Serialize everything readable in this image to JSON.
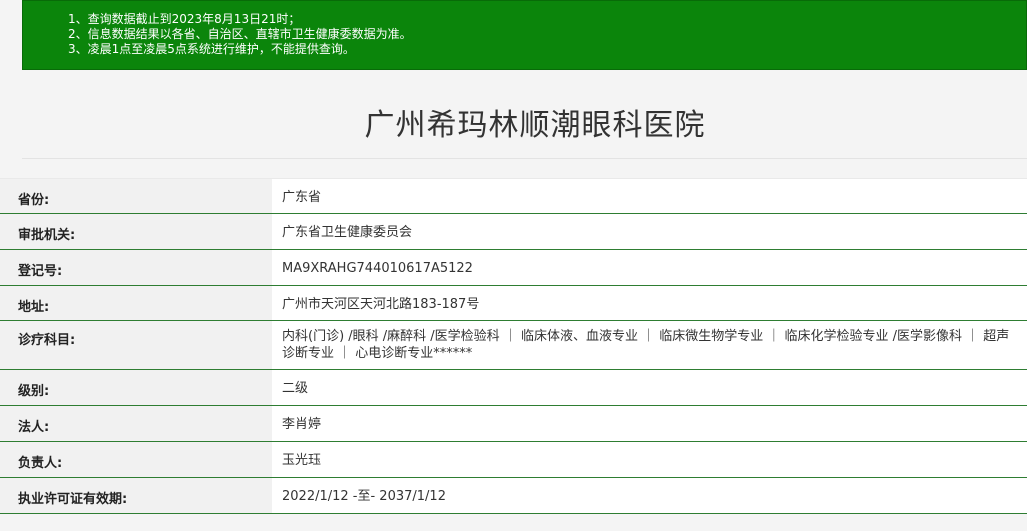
{
  "notice": {
    "lines": [
      "1、查询数据截止到2023年8月13日21时；",
      "2、信息数据结果以各省、自治区、直辖市卫生健康委数据为准。",
      "3、凌晨1点至凌晨5点系统进行维护，不能提供查询。"
    ],
    "background_color": "#0b850b"
  },
  "hospital": {
    "name": "广州希玛林顺潮眼科医院"
  },
  "info": {
    "rows": [
      {
        "label": "省份:",
        "value": "广东省"
      },
      {
        "label": "审批机关:",
        "value": "广东省卫生健康委员会"
      },
      {
        "label": "登记号:",
        "value": "MA9XRAHG744010617A5122"
      },
      {
        "label": "地址:",
        "value": "广州市天河区天河北路183-187号"
      },
      {
        "label": "诊疗科目:",
        "value": "内科(门诊) /眼科 /麻醉科 /医学检验科 ｜ 临床体液、血液专业 ｜ 临床微生物学专业 ｜ 临床化学检验专业 /医学影像科 ｜ 超声诊断专业 ｜ 心电诊断专业******"
      },
      {
        "label": "级别:",
        "value": "二级"
      },
      {
        "label": "法人:",
        "value": "李肖婷"
      },
      {
        "label": "负责人:",
        "value": "玉光珏"
      },
      {
        "label": "执业许可证有效期:",
        "value": "2022/1/12 -至- 2037/1/12"
      }
    ],
    "border_color": "#2e7d32"
  }
}
